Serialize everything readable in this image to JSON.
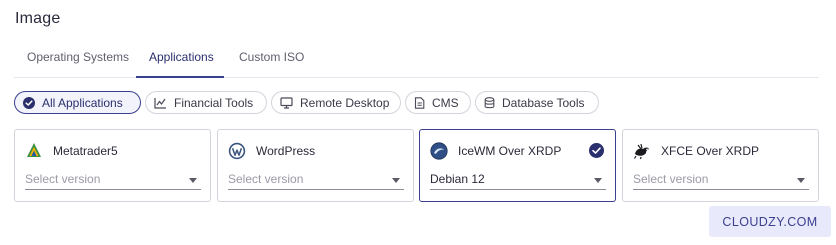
{
  "page": {
    "title": "Image"
  },
  "tabs": [
    {
      "label": "Operating Systems"
    },
    {
      "label": "Applications"
    },
    {
      "label": "Custom ISO"
    }
  ],
  "active_tab": "Applications",
  "filters": [
    {
      "label": "All Applications",
      "icon": "check-circle-icon"
    },
    {
      "label": "Financial Tools",
      "icon": "chart-icon"
    },
    {
      "label": "Remote Desktop",
      "icon": "monitor-icon"
    },
    {
      "label": "CMS",
      "icon": "document-icon"
    },
    {
      "label": "Database Tools",
      "icon": "database-icon"
    }
  ],
  "active_filter": "All Applications",
  "apps": [
    {
      "name": "Metatrader5",
      "version": "Select version",
      "selected": false,
      "icon": "metatrader-logo-icon"
    },
    {
      "name": "WordPress",
      "version": "Select version",
      "selected": false,
      "icon": "wordpress-logo-icon"
    },
    {
      "name": "IceWM Over XRDP",
      "version": "Debian 12",
      "selected": true,
      "icon": "icewm-logo-icon"
    },
    {
      "name": "XFCE Over XRDP",
      "version": "Select version",
      "selected": false,
      "icon": "xfce-logo-icon"
    }
  ],
  "brand": {
    "text": "CLOUDZY.COM"
  },
  "colors": {
    "accent": "#3b3f8f",
    "border": "#d4d4dc",
    "brand_bg": "#e8e9fb"
  }
}
